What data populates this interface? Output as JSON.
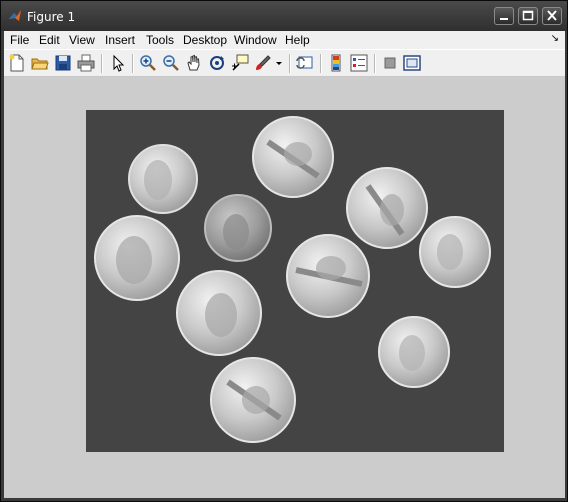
{
  "window": {
    "title": "Figure 1"
  },
  "menu": {
    "items": [
      "File",
      "Edit",
      "View",
      "Insert",
      "Tools",
      "Desktop",
      "Window",
      "Help"
    ],
    "dock_glyph": "↘"
  },
  "toolbar": {
    "icons": [
      "new-figure-icon",
      "open-file-icon",
      "save-icon",
      "print-icon",
      "edit-plot-arrow-icon",
      "zoom-in-icon",
      "zoom-out-icon",
      "pan-hand-icon",
      "rotate-3d-icon",
      "data-cursor-icon",
      "brush-icon",
      "link-plot-icon",
      "colorbar-icon",
      "legend-icon",
      "hide-plot-tools-icon",
      "show-plot-tools-icon"
    ]
  },
  "image": {
    "description_name": "coins",
    "colormap": "gray"
  }
}
